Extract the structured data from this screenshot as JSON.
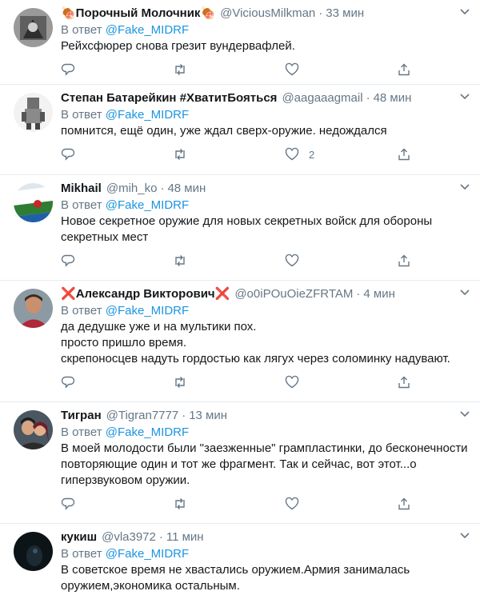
{
  "reply_prefix": "В ответ ",
  "mention": "@Fake_MIDRF",
  "colors": {
    "link": "#1b95e0",
    "muted": "#657786",
    "text": "#14171a",
    "border": "#e6ecf0",
    "cross": "#e0245e"
  },
  "tweets": [
    {
      "name": "🍖Порочный Молочник🍖",
      "handle": "@ViciousMilkman",
      "time": "33 мин",
      "text": "Рейхсфюрер снова грезит вундервафлей.",
      "like_count": ""
    },
    {
      "name": "Степан Батарейкин #ХватитБояться",
      "handle": "@aagaaagmail",
      "time": "48 мин",
      "text": "помнится, ещё один, уже ждал сверх-оружие. недождался",
      "like_count": "2"
    },
    {
      "name": "Mikhail",
      "handle": "@mih_ko",
      "time": "48 мин",
      "text": "Новое секретное оружие для новых секретных войск для обороны\nсекретных мест",
      "like_count": ""
    },
    {
      "name_cross_left": "❌",
      "name": "Александр Викторович",
      "name_cross_right": "❌",
      "handle": "@o0iPOuOieZFRTAM",
      "time": "4 мин",
      "text": "да дедушке уже и на мультики пох.\nпросто пришло время.\nскрепоносцев надуть гордостью как лягух через соломинку надувают.",
      "like_count": ""
    },
    {
      "name": "Тигран",
      "handle": "@Tigran7777",
      "time": "13 мин",
      "text": "В моей молодости были \"заезженные\" грампластинки, до бесконечности\nповторяющие один и тот же фрагмент. Так и сейчас, вот этот...о\nгиперзвуковом оружии.",
      "like_count": ""
    },
    {
      "name": "кукиш",
      "handle": "@vla3972",
      "time": "11 мин",
      "text": "В советское время не хвастались оружием.Армия занималась\nоружием,экономика остальным.",
      "like_count": ""
    }
  ]
}
